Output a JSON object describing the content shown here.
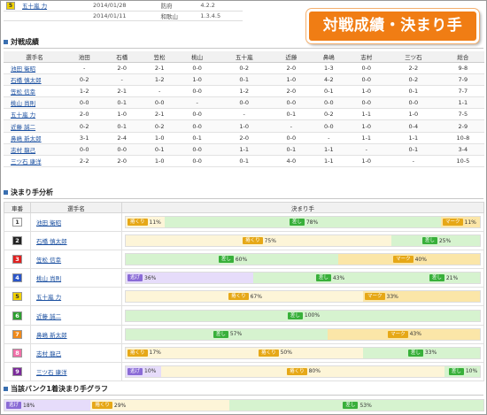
{
  "top": {
    "rank_badge": "5",
    "player_name": "五十嵐 力",
    "rows": [
      {
        "date": "2014/01/28",
        "venue": "防府",
        "value": "4.2.2"
      },
      {
        "date": "2014/01/11",
        "venue": "和歌山",
        "value": "1.3.4.5"
      }
    ]
  },
  "banner": {
    "title": "対戦成績・決まり手"
  },
  "matrix": {
    "section_title": "対戦成績",
    "headers": [
      "選手名",
      "池田",
      "石橋",
      "笠松",
      "桃山",
      "五十嵐",
      "近藤",
      "鼻嶋",
      "志村",
      "三ツ石",
      "総合"
    ],
    "rows": [
      {
        "name": "池田 衛昭",
        "cells": [
          "-",
          "2-0",
          "2-1",
          "0-0",
          "0-2",
          "2-0",
          "1-3",
          "0-0",
          "2-2",
          "9-8"
        ]
      },
      {
        "name": "石橋 慎太郎",
        "cells": [
          "0-2",
          "-",
          "1-2",
          "1-0",
          "0-1",
          "1-0",
          "4-2",
          "0-0",
          "0-2",
          "7-9"
        ]
      },
      {
        "name": "笠松 信幸",
        "cells": [
          "1-2",
          "2-1",
          "-",
          "0-0",
          "1-2",
          "2-0",
          "0-1",
          "1-0",
          "0-1",
          "7-7"
        ]
      },
      {
        "name": "桃山 尚則",
        "cells": [
          "0-0",
          "0-1",
          "0-0",
          "-",
          "0-0",
          "0-0",
          "0-0",
          "0-0",
          "0-0",
          "1-1"
        ]
      },
      {
        "name": "五十嵐 力",
        "cells": [
          "2-0",
          "1-0",
          "2-1",
          "0-0",
          "-",
          "0-1",
          "0-2",
          "1-1",
          "1-0",
          "7-5"
        ]
      },
      {
        "name": "近藤 誠二",
        "cells": [
          "0-2",
          "0-1",
          "0-2",
          "0-0",
          "1-0",
          "-",
          "0-0",
          "1-0",
          "0-4",
          "2-9"
        ]
      },
      {
        "name": "鼻嶋 新太郎",
        "cells": [
          "3-1",
          "2-4",
          "1-0",
          "0-1",
          "2-0",
          "0-0",
          "-",
          "1-1",
          "1-1",
          "10-8"
        ]
      },
      {
        "name": "志村 龍己",
        "cells": [
          "0-0",
          "0-0",
          "0-1",
          "0-0",
          "1-1",
          "0-1",
          "1-1",
          "-",
          "0-1",
          "3-4"
        ]
      },
      {
        "name": "三ツ石 康洋",
        "cells": [
          "2-2",
          "2-0",
          "1-0",
          "0-0",
          "0-1",
          "4-0",
          "1-1",
          "1-0",
          "-",
          "10-5"
        ]
      }
    ]
  },
  "kimarite": {
    "section_title": "決まり手分析",
    "headers": [
      "車番",
      "選手名",
      "決まり手"
    ],
    "legend": {
      "nige": "逃げ",
      "makuri": "捲くり",
      "sashi": "差し",
      "mark": "マーク"
    },
    "colors": {
      "nige": "#8a6bd6",
      "makuri": "#e6a817",
      "sashi": "#38b03a",
      "mark": "#e6a817"
    },
    "rows": [
      {
        "rank": "1",
        "rank_bg": "#ffffff",
        "rank_fg": "#333333",
        "name": "池田 衛昭",
        "segs": [
          {
            "type": "makuri",
            "pct": 11,
            "text": "11%"
          },
          {
            "type": "sashi",
            "pct": 78,
            "text": "78%"
          },
          {
            "type": "mark",
            "pct": 11,
            "text": "11%"
          }
        ]
      },
      {
        "rank": "2",
        "rank_bg": "#222222",
        "rank_fg": "#ffffff",
        "name": "石橋 慎太郎",
        "segs": [
          {
            "type": "makuri",
            "pct": 75,
            "text": "75%"
          },
          {
            "type": "sashi",
            "pct": 25,
            "text": "25%"
          }
        ]
      },
      {
        "rank": "3",
        "rank_bg": "#e02020",
        "rank_fg": "#ffffff",
        "name": "笠松 信幸",
        "segs": [
          {
            "type": "sashi",
            "pct": 60,
            "text": "60%"
          },
          {
            "type": "mark",
            "pct": 40,
            "text": "40%"
          }
        ]
      },
      {
        "rank": "4",
        "rank_bg": "#2a55c8",
        "rank_fg": "#ffffff",
        "name": "桃山 尚則",
        "segs": [
          {
            "type": "nige",
            "pct": 36,
            "text": "36%"
          },
          {
            "type": "sashi",
            "pct": 43,
            "text": "43%"
          },
          {
            "type": "sashi",
            "pct": 21,
            "text": "21%"
          }
        ]
      },
      {
        "rank": "5",
        "rank_bg": "#f2d200",
        "rank_fg": "#333333",
        "name": "五十嵐 力",
        "segs": [
          {
            "type": "makuri",
            "pct": 67,
            "text": "67%"
          },
          {
            "type": "mark",
            "pct": 33,
            "text": "33%"
          }
        ]
      },
      {
        "rank": "6",
        "rank_bg": "#2da030",
        "rank_fg": "#ffffff",
        "name": "近藤 誠二",
        "segs": [
          {
            "type": "sashi",
            "pct": 100,
            "text": "100%"
          }
        ]
      },
      {
        "rank": "7",
        "rank_bg": "#f08a1a",
        "rank_fg": "#ffffff",
        "name": "鼻嶋 新太郎",
        "segs": [
          {
            "type": "sashi",
            "pct": 57,
            "text": "57%"
          },
          {
            "type": "mark",
            "pct": 43,
            "text": "43%"
          }
        ]
      },
      {
        "rank": "8",
        "rank_bg": "#f06fa8",
        "rank_fg": "#ffffff",
        "name": "志村 龍己",
        "segs": [
          {
            "type": "makuri",
            "pct": 17,
            "text": "17%"
          },
          {
            "type": "makuri",
            "pct": 50,
            "text": "50%"
          },
          {
            "type": "sashi",
            "pct": 33,
            "text": "33%"
          }
        ]
      },
      {
        "rank": "9",
        "rank_bg": "#7a2a9a",
        "rank_fg": "#ffffff",
        "name": "三ツ石 康洋",
        "segs": [
          {
            "type": "nige",
            "pct": 10,
            "text": "10%"
          },
          {
            "type": "makuri",
            "pct": 80,
            "text": "80%"
          },
          {
            "type": "sashi",
            "pct": 10,
            "text": "10%"
          }
        ]
      }
    ]
  },
  "bank": {
    "section_title": "当該バンク1着決まり手グラフ",
    "segs": [
      {
        "type": "nige",
        "pct": 18,
        "text": "18%"
      },
      {
        "type": "makuri",
        "pct": 29,
        "text": "29%"
      },
      {
        "type": "sashi",
        "pct": 53,
        "text": "53%"
      }
    ]
  }
}
